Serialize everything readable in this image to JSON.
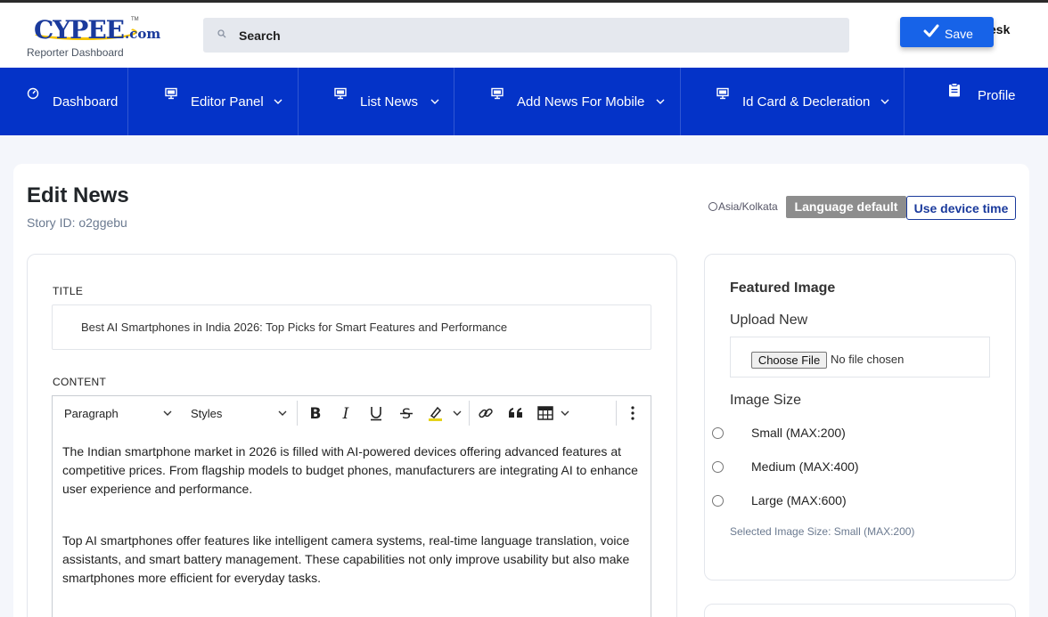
{
  "header": {
    "logo_text": "CYPEE",
    "logo_com": ".com",
    "logo_tm": "TM",
    "logo_subtitle": "Reporter Dashboard",
    "search_placeholder": "Search",
    "desk_text": "esk",
    "save_label": "Save"
  },
  "nav": {
    "items": [
      {
        "label": "Dashboard",
        "icon": "gauge-icon"
      },
      {
        "label": "Editor Panel",
        "icon": "monitor-icon"
      },
      {
        "label": "List News",
        "icon": "monitor-icon"
      },
      {
        "label": "Add News For Mobile",
        "icon": "monitor-icon"
      },
      {
        "label": "Id Card & Decleration",
        "icon": "monitor-icon"
      },
      {
        "label": "Profile",
        "icon": "clipboard-icon"
      }
    ]
  },
  "page": {
    "title": "Edit News",
    "story_id": "Story ID: o2ggebu",
    "timezone": "Asia/Kolkata",
    "language_badge": "Language default",
    "device_time_label": "Use device time"
  },
  "form": {
    "title_label": "TITLE",
    "title_value": "Best AI Smartphones in India 2026: Top Picks for Smart Features and Performance",
    "content_label": "CONTENT",
    "toolbar": {
      "paragraph": "Paragraph",
      "styles": "Styles"
    },
    "paragraphs": [
      "The Indian smartphone market in 2026 is filled with AI-powered devices offering advanced features at competitive prices. From flagship models to budget phones, manufacturers are integrating AI to enhance user experience and performance.",
      "Top AI smartphones offer features like intelligent camera systems, real-time language translation, voice assistants, and smart battery management. These capabilities not only improve usability but also make smartphones more efficient for everyday tasks."
    ]
  },
  "featured_image": {
    "title": "Featured Image",
    "upload_label": "Upload New",
    "choose_file": "Choose File",
    "no_file": "No file chosen",
    "size_label": "Image Size",
    "sizes": [
      "Small (MAX:200)",
      "Medium (MAX:400)",
      "Large (MAX:600)"
    ],
    "selected": "Selected Image Size: Small (MAX:200)"
  },
  "colors": {
    "nav_bg": "#0433c8",
    "save_bg": "#1763e8",
    "badge_bg": "#8d8d8d",
    "brand_blue": "#1a3a9c"
  }
}
